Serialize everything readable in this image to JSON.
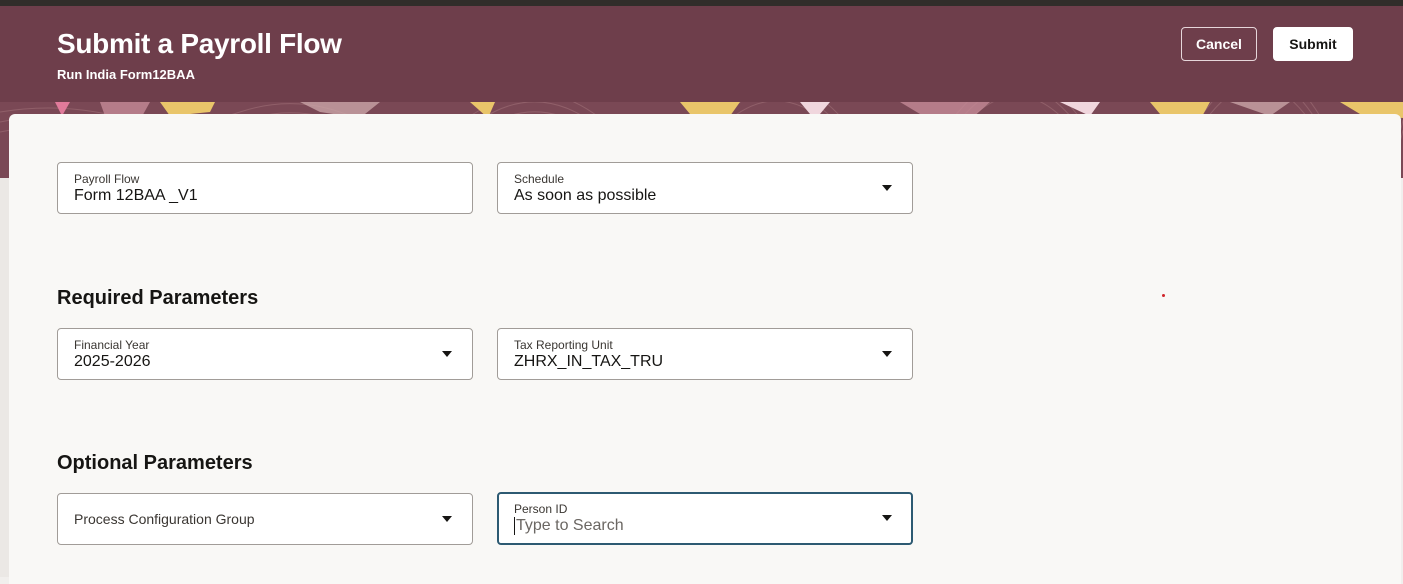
{
  "header": {
    "title": "Submit a Payroll Flow",
    "subtitle": "Run India Form12BAA",
    "cancel_label": "Cancel",
    "submit_label": "Submit",
    "background_color": "#6e3e4b"
  },
  "form": {
    "payroll_flow": {
      "label": "Payroll Flow",
      "value": "Form 12BAA _V1"
    },
    "schedule": {
      "label": "Schedule",
      "value": "As soon as possible"
    }
  },
  "required_parameters": {
    "title": "Required Parameters",
    "financial_year": {
      "label": "Financial Year",
      "value": "2025-2026"
    },
    "tax_reporting_unit": {
      "label": "Tax Reporting Unit",
      "value": "ZHRX_IN_TAX_TRU"
    }
  },
  "optional_parameters": {
    "title": "Optional Parameters",
    "process_configuration_group": {
      "placeholder": "Process Configuration Group"
    },
    "person_id": {
      "label": "Person ID",
      "placeholder": "Type to Search"
    }
  },
  "icons": {
    "dropdown": "chevron-down-icon"
  }
}
